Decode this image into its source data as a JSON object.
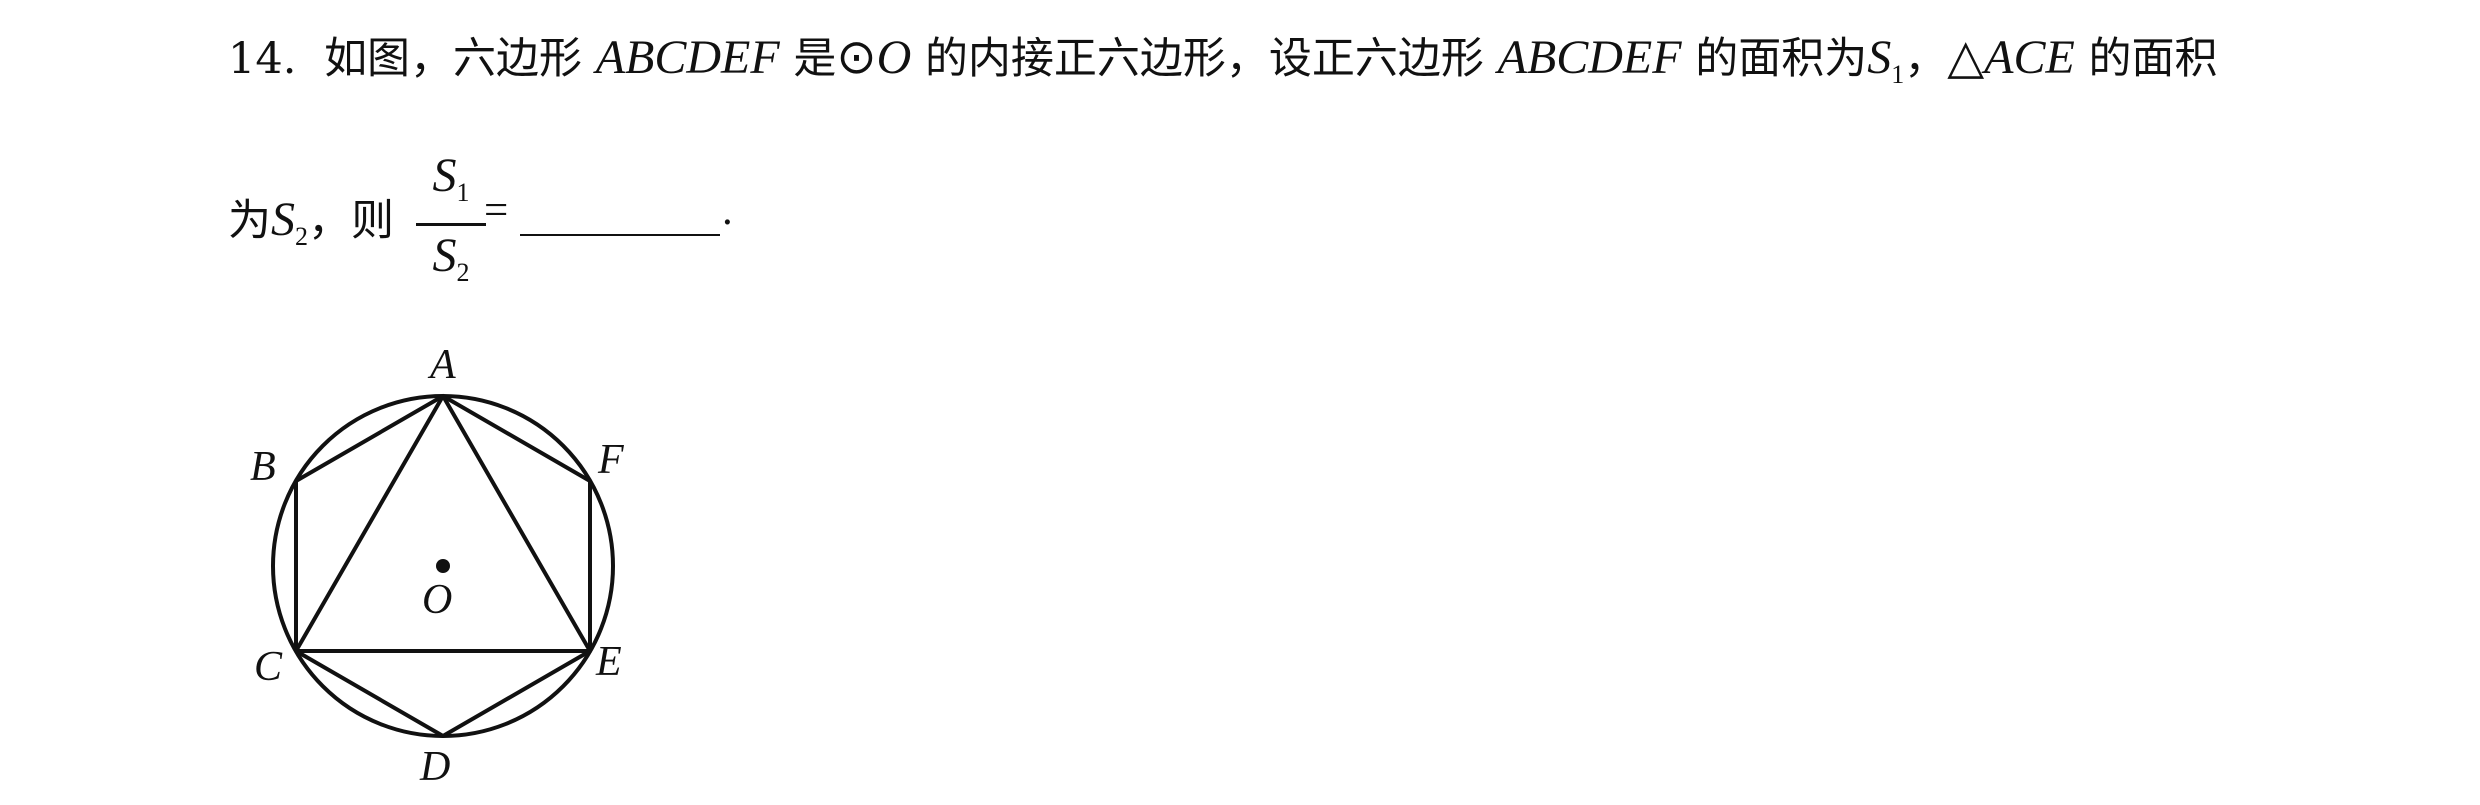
{
  "problem": {
    "number": "14.",
    "line1": {
      "p1": "如图，六边形",
      "hexagon_name": "ABCDEF",
      "p2": "是",
      "circle_symbol": "⊙",
      "circle_center": "O",
      "p3": "的内接正六边形，设正六边形",
      "hexagon_name_2": "ABCDEF",
      "p4": "的面积为",
      "s1_letter": "S",
      "s1_index": "1",
      "p5": "，",
      "triangle_symbol": "△",
      "triangle_name": "ACE",
      "p6": "的面积"
    },
    "line2": {
      "p1": "为",
      "s2_letter": "S",
      "s2_index": "2",
      "p2": "，则",
      "frac_num_letter": "S",
      "frac_num_index": "1",
      "frac_den_letter": "S",
      "frac_den_index": "2",
      "equals": "=",
      "period": "."
    }
  },
  "figure": {
    "labels": {
      "A": "A",
      "B": "B",
      "C": "C",
      "D": "D",
      "E": "E",
      "F": "F",
      "O": "O"
    }
  }
}
